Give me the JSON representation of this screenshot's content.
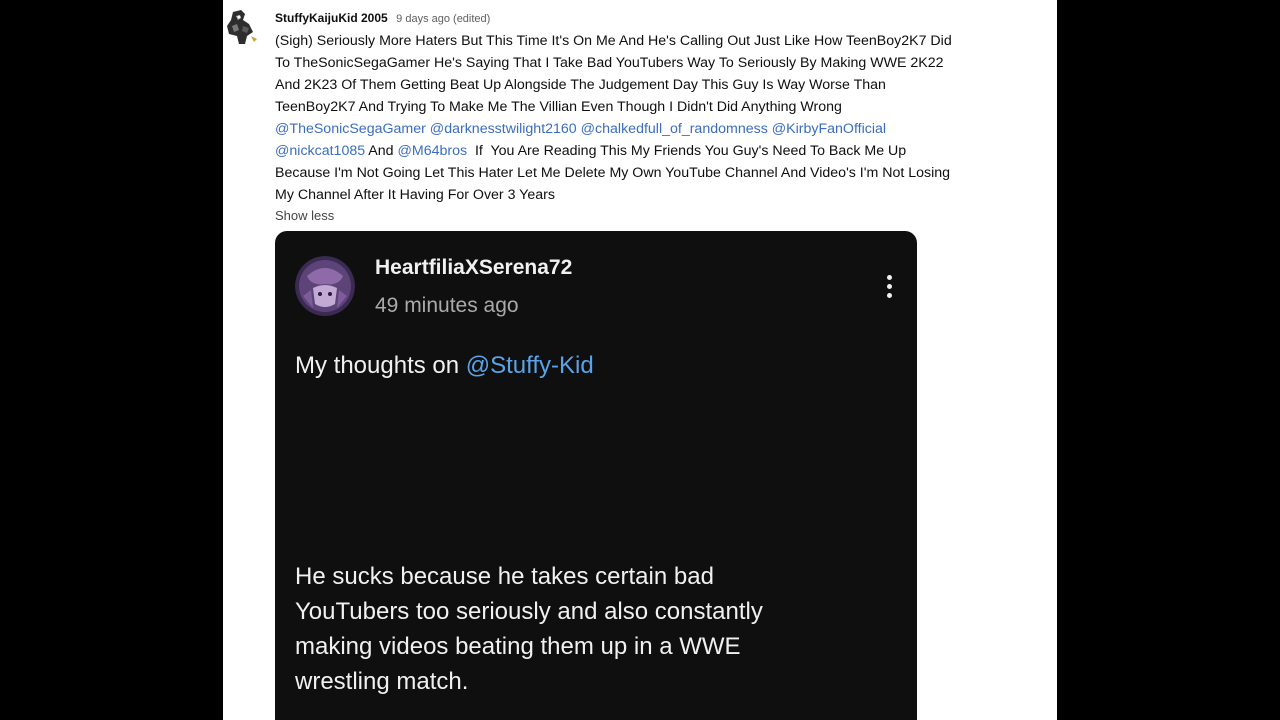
{
  "comment": {
    "author": "StuffyKaijuKid 2005",
    "meta": "9 days ago (edited)",
    "body_lines": [
      "(Sigh) Seriously More Haters But This Time It's On Me And He's Calling Out Just Like How TeenBoy2K7 Did",
      "To TheSonicSegaGamer He's Saying That I Take Bad YouTubers Way To Seriously By Making WWE 2K22",
      "And 2K23 Of Them Getting Beat Up Alongside The Judgement Day This Guy Is Way Worse Than",
      "TeenBoy2K7 And Trying To Make Me The Villian Even Though I Didn't Did Anything Wrong"
    ],
    "mentions_line": {
      "m1": "@TheSonicSegaGamer",
      "m2": "@darknesstwilight2160",
      "m3": "@chalkedfull_of_randomness",
      "m4": "@KirbyFanOfficial"
    },
    "mentions_line2": {
      "m5": "@nickcat1085",
      "and": " And ",
      "m6": "@M64bros",
      "tail": "  If  You Are Reading This My Friends You Guy's Need To Back Me Up"
    },
    "tail_lines": [
      "Because I'm Not Going Let This Hater Let Me Delete My Own YouTube Channel And Video's I'm Not Losing",
      "My Channel After It Having For Over 3 Years"
    ],
    "show_less_label": "Show less"
  },
  "embedded_comment": {
    "author": "HeartfiliaXSerena72",
    "time": "49 minutes ago",
    "line1_prefix": "My thoughts on ",
    "line1_mention": "@Stuffy-Kid",
    "paragraph_lines": [
      "He sucks because he takes certain bad",
      "YouTubers too seriously and also constantly",
      "making videos beating them up in a WWE",
      "wrestling match."
    ]
  },
  "icons": {
    "top_avatar": "kaiju-avatar-icon",
    "embed_avatar": "purple-character-avatar-icon",
    "more": "more-vertical-icon"
  },
  "colors": {
    "mention_light": "#3a6dc2",
    "mention_dark": "#5aa3e8",
    "embed_background": "#0f0f0f"
  }
}
